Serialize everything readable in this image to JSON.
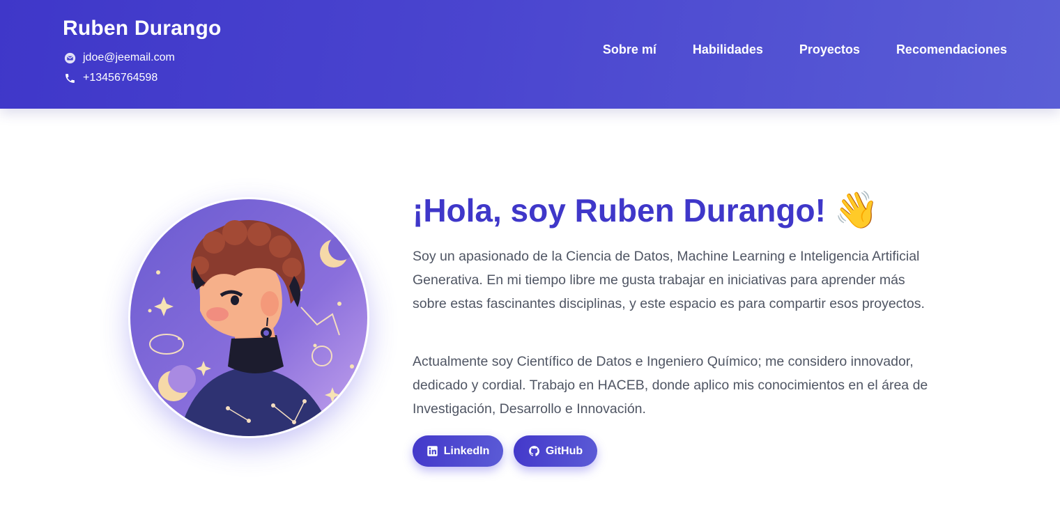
{
  "header": {
    "name": "Ruben Durango",
    "email": "jdoe@jeemail.com",
    "phone": "+13456764598",
    "nav": [
      "Sobre mí",
      "Habilidades",
      "Proyectos",
      "Recomendaciones"
    ]
  },
  "hero": {
    "greeting": "¡Hola, soy Ruben Durango!",
    "wave": "👋",
    "paragraph1": "Soy un apasionado de la Ciencia de Datos, Machine Learning e Inteligencia Artificial Generativa. En mi tiempo libre me gusta trabajar en iniciativas para aprender más sobre estas fascinantes disciplinas, y este espacio es para compartir esos proyectos.",
    "paragraph2": "Actualmente soy Científico de Datos e Ingeniero Químico; me considero innovador, dedicado y cordial. Trabajo en HACEB, donde aplico mis conocimientos en el área de Investigación, Desarrollo e Innovación.",
    "buttons": {
      "linkedin": "LinkedIn",
      "github": "GitHub"
    }
  },
  "icons": {
    "email": "email-icon",
    "phone": "phone-icon",
    "linkedin": "linkedin-icon",
    "github": "github-icon",
    "avatar": "avatar-illustration"
  },
  "colors": {
    "brand": "#3f37c9",
    "header_gradient_end": "#5a5ed6",
    "text_body": "#4f5563"
  }
}
